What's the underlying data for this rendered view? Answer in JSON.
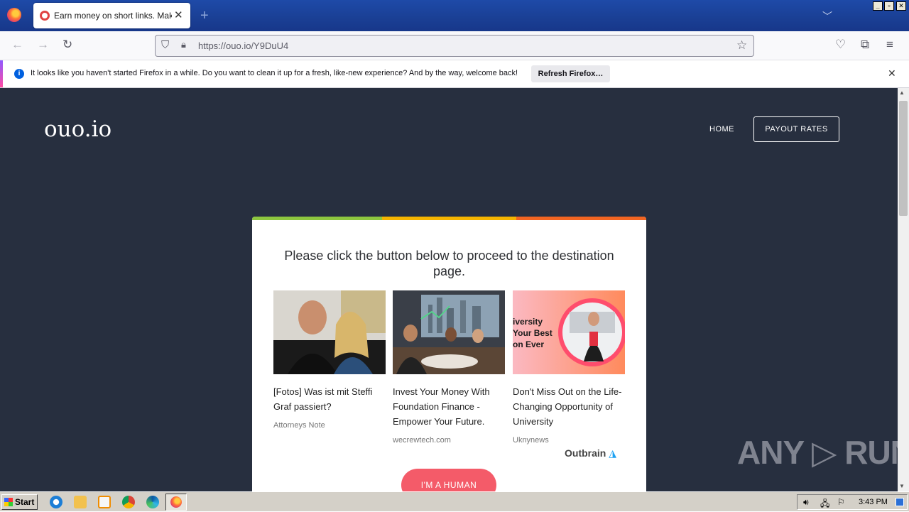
{
  "browser": {
    "tab": {
      "title": "Earn money on short links. Make sh",
      "close": "✕"
    },
    "new_tab": "+",
    "url": "https://ouo.io/Y9DuU4",
    "notification": {
      "text": "It looks like you haven't started Firefox in a while. Do you want to clean it up for a fresh, like-new experience? And by the way, welcome back!",
      "button": "Refresh Firefox…",
      "info": "i"
    }
  },
  "site": {
    "logo": "ouo.io",
    "nav": {
      "home": "HOME",
      "payout": "PAYOUT RATES"
    },
    "card": {
      "title": "Please click the button below to proceed to the destination page.",
      "ads": [
        {
          "text": "[Fotos] Was ist mit Steffi Graf passiert?",
          "source": "Attorneys Note"
        },
        {
          "text": "Invest Your Money With Foundation Finance - Empower Your Future.",
          "source": "wecrewtech.com"
        },
        {
          "text": "Don't Miss Out on the Life-Changing Opportunity of University",
          "source": "Uknynews",
          "image_text": "iversity\nYour Best\non Ever"
        }
      ],
      "outbrain": "Outbrain",
      "button": "I'M A HUMAN"
    },
    "watermark": "ANY ▷ RUN"
  },
  "taskbar": {
    "start": "Start",
    "clock": "3:43 PM"
  },
  "colors": {
    "page_bg": "#272f3f",
    "button": "#f45b69",
    "stripe": [
      "#8dc63f",
      "#f5b400",
      "#f26522"
    ]
  }
}
